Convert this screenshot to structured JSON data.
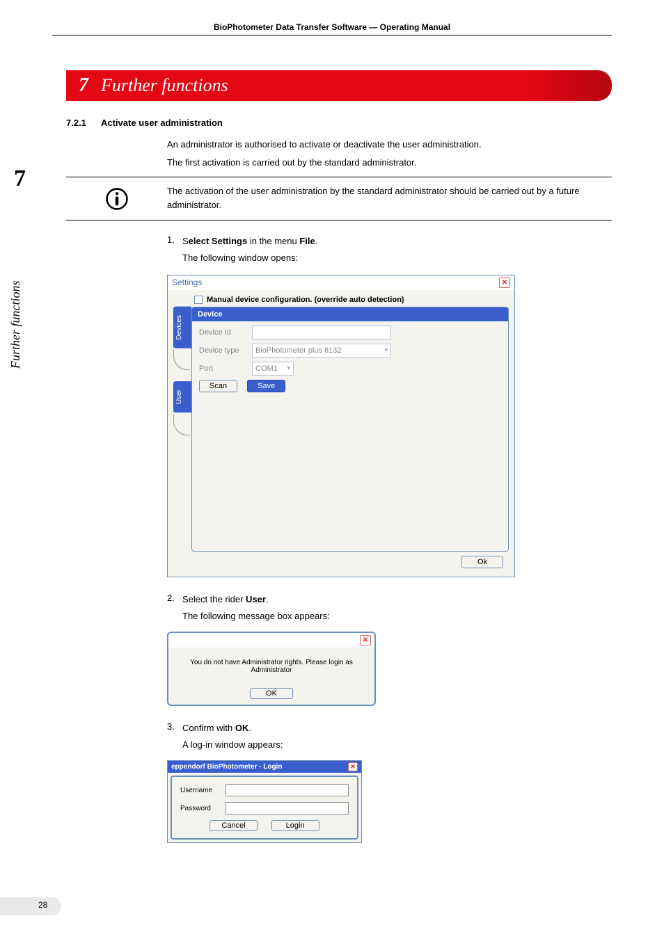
{
  "header": "BioPhotometer Data Transfer Software  —  Operating Manual",
  "chapter": {
    "num": "7",
    "title": "Further functions"
  },
  "sideMargin": {
    "big": "7",
    "label": "Further functions"
  },
  "section": {
    "num": "7.2.1",
    "title": "Activate user administration",
    "p1": "An administrator is authorised to activate or deactivate the user administration.",
    "p2": "The first activation is carried out by the standard administrator."
  },
  "info": "The activation of the user administration by the standard administrator should be carried out by a future administrator.",
  "steps": {
    "s1": {
      "num": "1.",
      "pre": "S",
      "bold1": "elect Settings",
      "mid": " in the menu ",
      "bold2": "File",
      "post": ".",
      "after": "The following window opens:"
    },
    "s2": {
      "num": "2.",
      "pre": "Select the rider ",
      "bold": "User",
      "post": ".",
      "after": "The following message box appears:"
    },
    "s3": {
      "num": "3.",
      "pre": "Confirm with ",
      "bold": "OK",
      "post": ".",
      "after": "A log-in window appears:"
    }
  },
  "settings": {
    "title": "Settings",
    "checkbox": "Manual device configuration.  (override auto detection)",
    "tabs": {
      "devices": "Devices",
      "user": "User"
    },
    "panel": {
      "heading": "Device",
      "rows": {
        "id": {
          "label": "Device Id",
          "value": ""
        },
        "type": {
          "label": "Device type",
          "value": "BioPhotometer plus 6132"
        },
        "port": {
          "label": "Port",
          "value": "COM1"
        }
      },
      "buttons": {
        "scan": "Scan",
        "save": "Save"
      }
    },
    "ok": "Ok"
  },
  "msg": {
    "text": "You do not have Administrator rights. Please login as Administrator",
    "ok": "OK"
  },
  "login": {
    "title": "eppendorf BioPhotometer - Login",
    "username": "Username",
    "password": "Password",
    "cancel": "Cancel",
    "loginBtn": "Login"
  },
  "pageNum": "28"
}
